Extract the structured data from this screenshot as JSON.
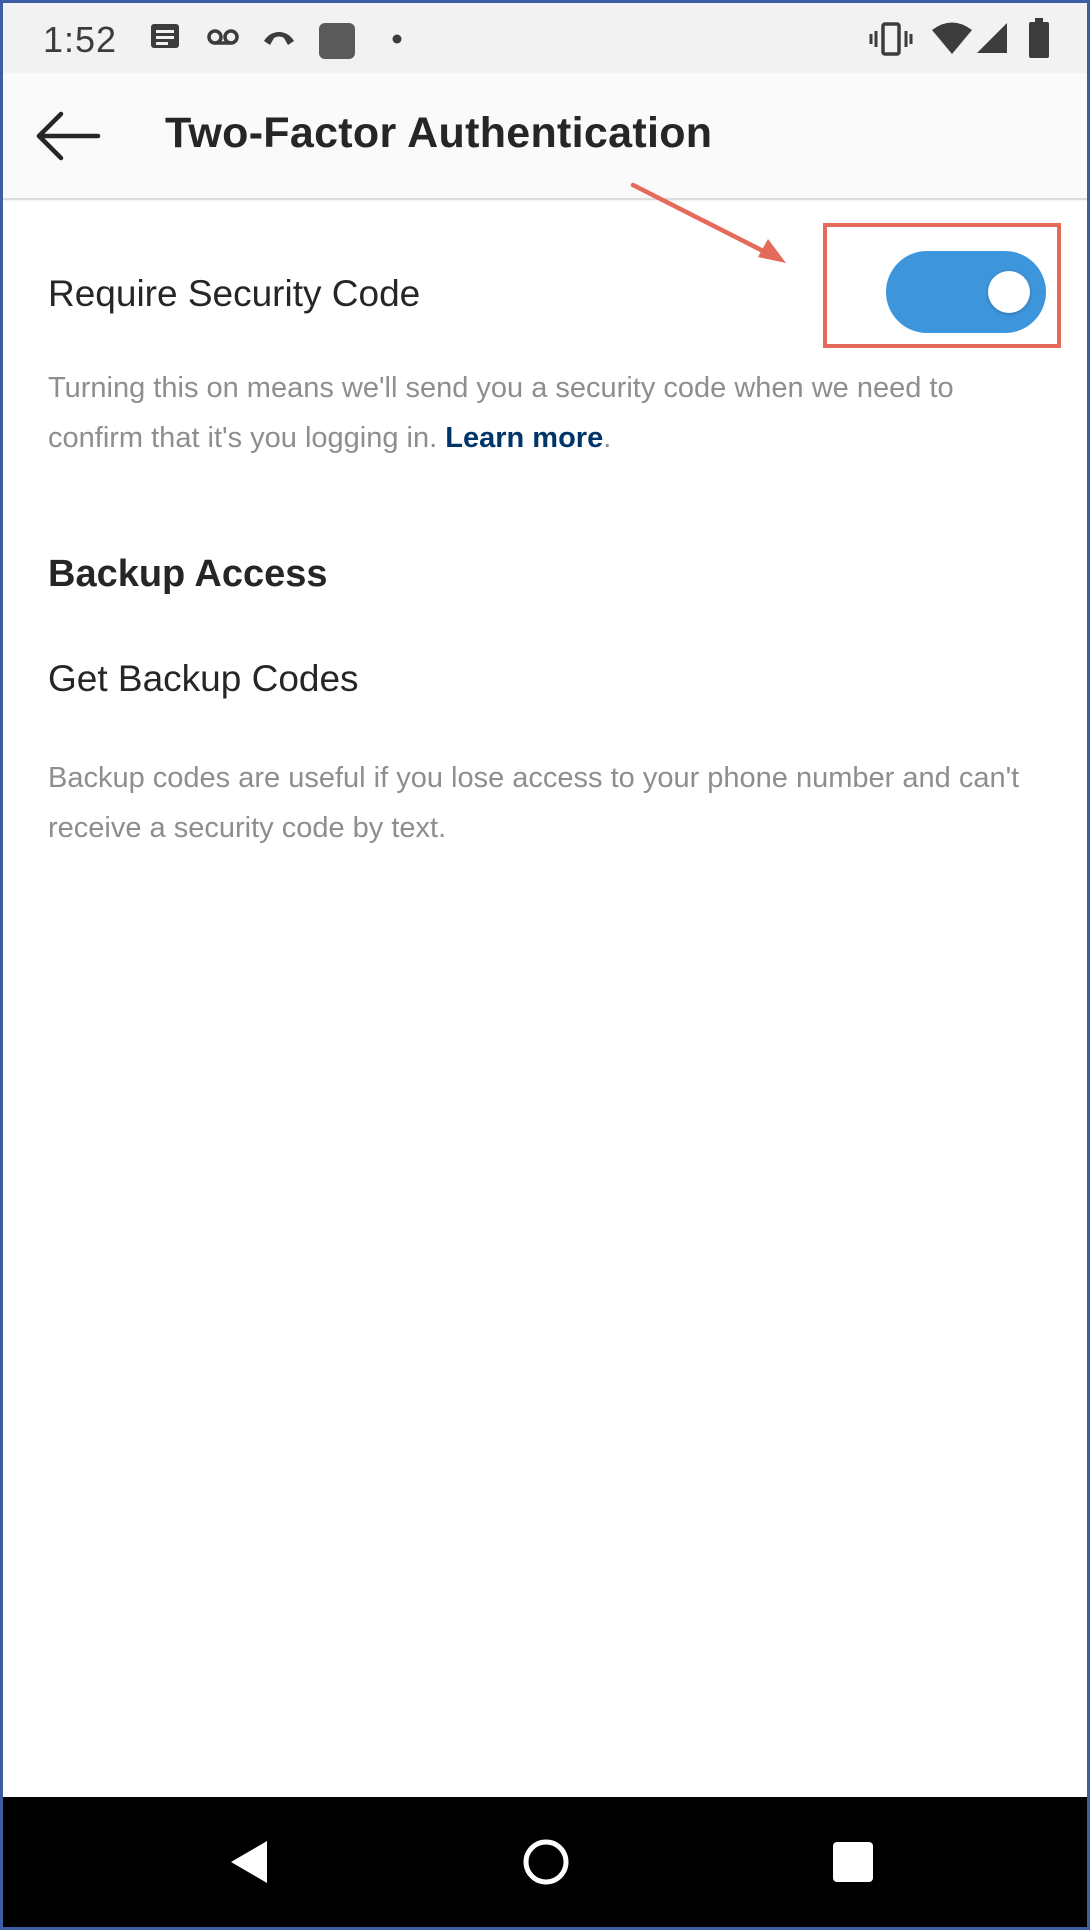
{
  "status_bar": {
    "time": "1:52",
    "left_icons": [
      "message-icon",
      "voicemail-icon",
      "call-icon",
      "app-icon",
      "dot-icon"
    ],
    "right_icons": [
      "vibrate-icon",
      "wifi-icon",
      "signal-icon",
      "battery-icon"
    ]
  },
  "app_bar": {
    "title": "Two-Factor Authentication",
    "back_icon": "back-arrow-icon"
  },
  "security_code": {
    "label": "Require Security Code",
    "enabled": true,
    "description": "Turning this on means we'll send you a security code when we need to confirm that it's you logging in.",
    "learn_more": "Learn more",
    "punct": "."
  },
  "backup": {
    "section_title": "Backup Access",
    "item_label": "Get Backup Codes",
    "description": "Backup codes are useful if you lose access to your phone number and can't receive a security code by text."
  },
  "nav_bar": {
    "icons": [
      "back-triangle-icon",
      "home-circle-icon",
      "recents-square-icon"
    ]
  },
  "colors": {
    "toggle_on": "#3d95dc",
    "link": "#003569",
    "annotation": "#e46a5a",
    "secondary_text": "#8e8e8e",
    "primary_text": "#262626"
  }
}
